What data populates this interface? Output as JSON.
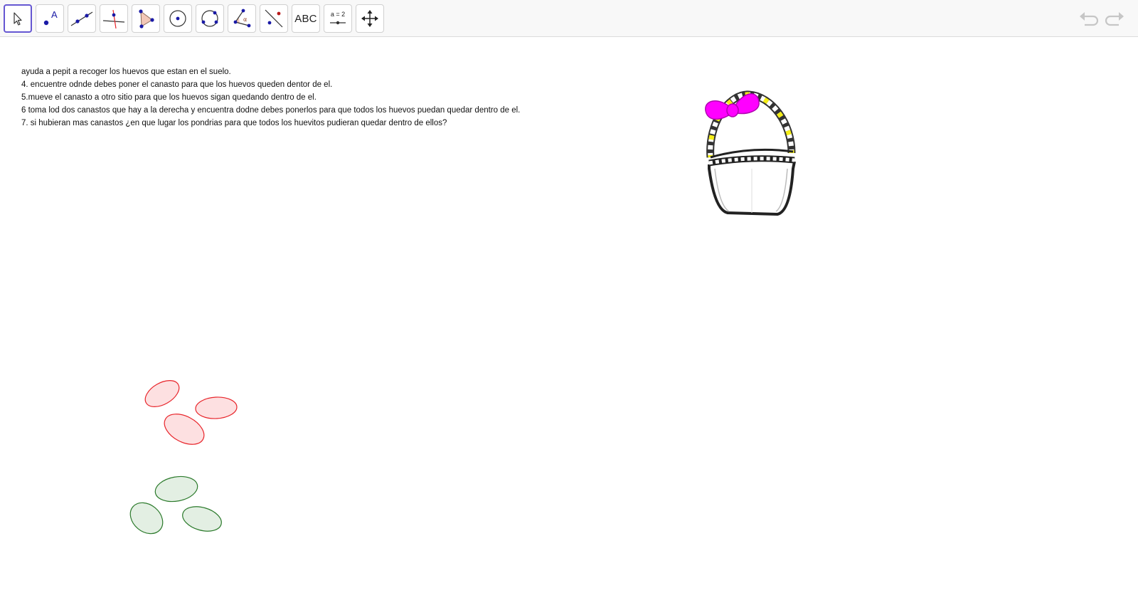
{
  "toolbar": {
    "tools": [
      {
        "name": "move-tool",
        "icon": "arrow-cursor-icon",
        "selected": true
      },
      {
        "name": "point-tool",
        "icon": "point-icon",
        "label": "A"
      },
      {
        "name": "line-tool",
        "icon": "line-through-points-icon"
      },
      {
        "name": "perpendicular-line-tool",
        "icon": "perpendicular-line-icon"
      },
      {
        "name": "polygon-tool",
        "icon": "polygon-icon"
      },
      {
        "name": "circle-center-point-tool",
        "icon": "circle-center-icon"
      },
      {
        "name": "circle-three-points-tool",
        "icon": "circle-three-points-icon"
      },
      {
        "name": "angle-tool",
        "icon": "angle-icon",
        "label": "α"
      },
      {
        "name": "reflect-tool",
        "icon": "reflect-about-line-icon"
      },
      {
        "name": "text-tool",
        "icon": "text-icon",
        "label": "ABC"
      },
      {
        "name": "slider-tool",
        "icon": "slider-icon",
        "label": "a = 2"
      },
      {
        "name": "move-graphics-view-tool",
        "icon": "move-arrows-icon"
      }
    ],
    "undo_icon": "undo-icon",
    "redo_icon": "redo-icon"
  },
  "instructions": [
    "ayuda a pepit a recoger los huevos que estan en el suelo.",
    "4. encuentre odnde debes poner el canasto para que los huevos queden dentor de el.",
    "5.mueve el canasto a otro sitio para que los huevos sigan quedando dentro de el.",
    "6 toma lod dos canastos que hay a la derecha y encuentra dodne debes ponerlos para que todos los huevos puedan quedar dentro de el.",
    "7. si hubieran mas canastos ¿en que lugar los pondrias para que todos los huevitos pudieran quedar dentro de ellos?"
  ],
  "colors": {
    "selected_border": "#6557d2",
    "point_blue": "#1a1aa6",
    "red_egg_stroke": "#e8242a",
    "red_egg_fill": "#fde0e1",
    "green_egg_stroke": "#2b7a2b",
    "green_egg_fill": "#e3efe3",
    "bow": "#ff00ff",
    "handle_accent": "#f4ee16"
  }
}
